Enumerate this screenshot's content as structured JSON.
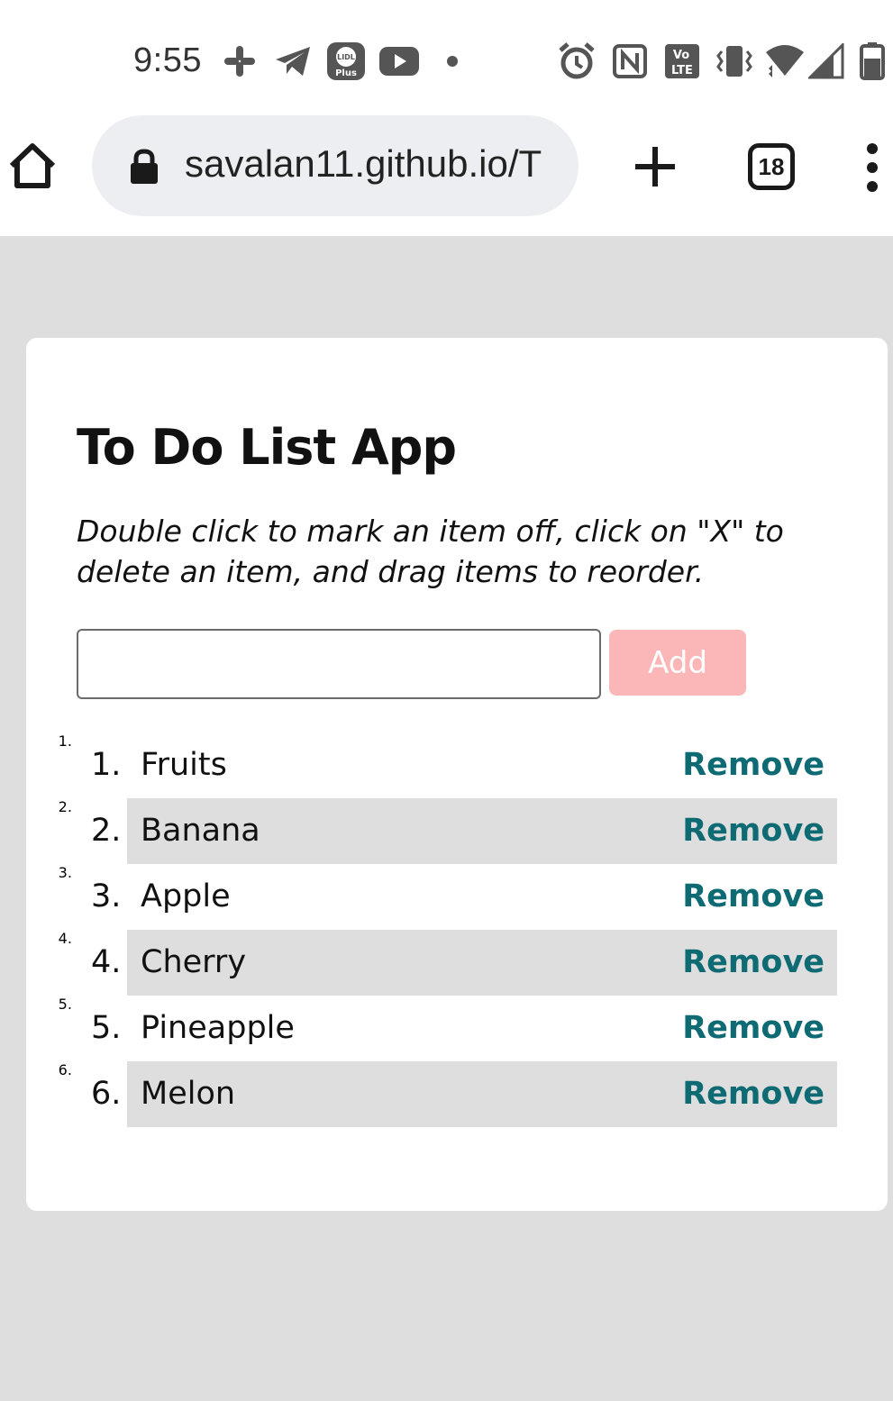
{
  "status_bar": {
    "time": "9:55",
    "notification_icons": [
      "slack-icon",
      "telegram-icon",
      "lidl-plus-icon",
      "youtube-icon",
      "dot-icon"
    ],
    "lidl_text_top": "LIDL",
    "lidl_text_bottom": "Plus",
    "system_icons": [
      "alarm-icon",
      "nfc-icon",
      "volte-icon",
      "vibrate-icon",
      "wifi-icon",
      "signal-icon",
      "battery-icon"
    ],
    "volte_top": "Vo",
    "volte_bottom": "LTE"
  },
  "browser": {
    "url": "savalan11.github.io/T",
    "tab_count": "18"
  },
  "app": {
    "title": "To Do List App",
    "description": "Double click to mark an item off, click on \"X\" to delete an item, and drag items to reorder.",
    "input_value": "",
    "add_label": "Add",
    "items": [
      {
        "number": "1.",
        "label": "Fruits",
        "remove_label": "Remove"
      },
      {
        "number": "2.",
        "label": "Banana",
        "remove_label": "Remove"
      },
      {
        "number": "3.",
        "label": "Apple",
        "remove_label": "Remove"
      },
      {
        "number": "4.",
        "label": "Cherry",
        "remove_label": "Remove"
      },
      {
        "number": "5.",
        "label": "Pineapple",
        "remove_label": "Remove"
      },
      {
        "number": "6.",
        "label": "Melon",
        "remove_label": "Remove"
      }
    ],
    "colors": {
      "page_background": "#dedede",
      "add_button": "#fbb6b8",
      "remove_link": "#0e6a73",
      "alt_row": "#dedede"
    }
  }
}
